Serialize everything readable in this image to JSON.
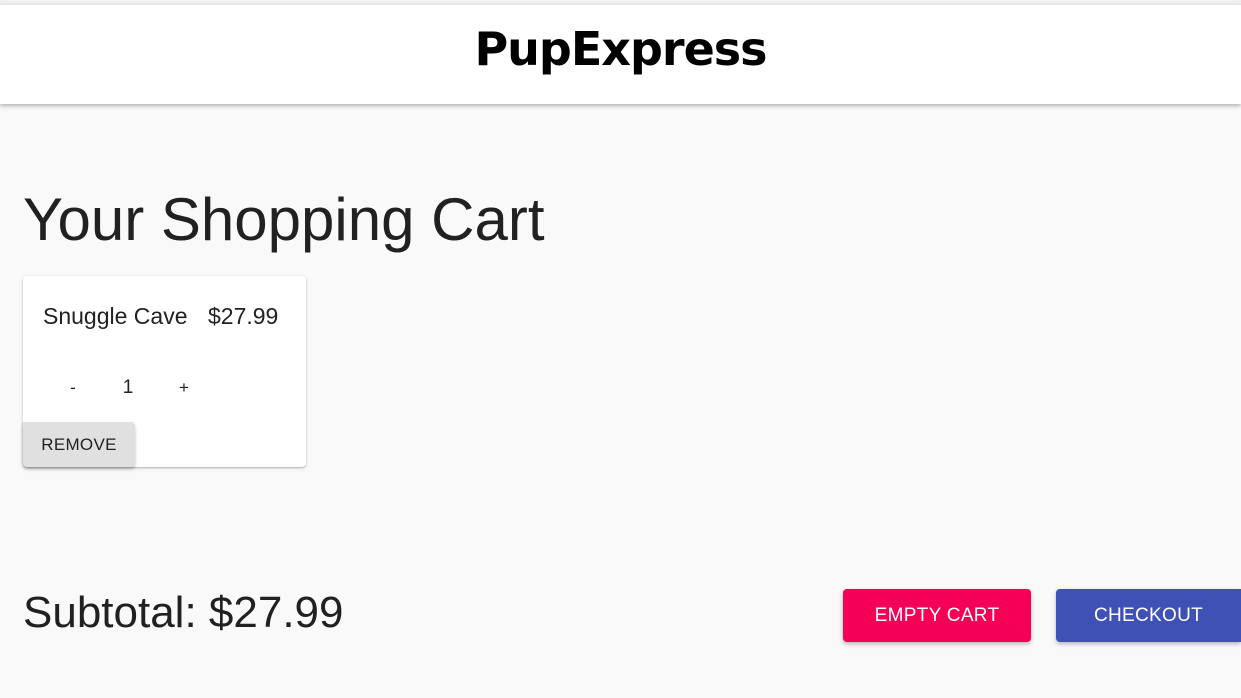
{
  "header": {
    "brand": "PupExpress"
  },
  "page": {
    "title": "Your Shopping Cart"
  },
  "cart": {
    "items": [
      {
        "name": "Snuggle Cave",
        "price": "$27.99",
        "quantity": "1",
        "decrement_label": "-",
        "increment_label": "+",
        "remove_label": "REMOVE"
      }
    ]
  },
  "summary": {
    "subtotal": "Subtotal: $27.99",
    "empty_cart_label": "EMPTY CART",
    "checkout_label": "CHECKOUT"
  },
  "colors": {
    "background": "#f9f9f9",
    "empty_cart": "#f50057",
    "checkout": "#3f51b5",
    "remove": "#e0e0e0"
  }
}
